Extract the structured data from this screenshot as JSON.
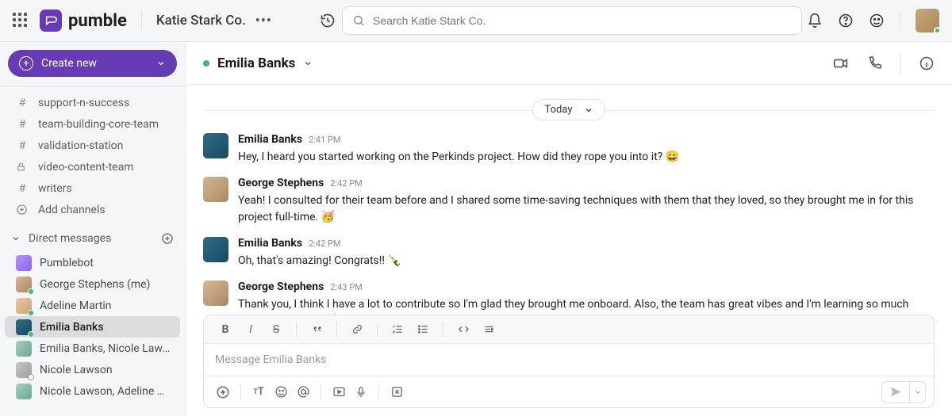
{
  "brand": "pumble",
  "org_name": "Katie Stark Co.",
  "search": {
    "placeholder": "Search Katie Stark Co."
  },
  "create_label": "Create new",
  "channels": [
    {
      "icon": "hash",
      "label": "support-n-success"
    },
    {
      "icon": "hash",
      "label": "team-building-core-team"
    },
    {
      "icon": "hash",
      "label": "validation-station"
    },
    {
      "icon": "lock",
      "label": "video-content-team"
    },
    {
      "icon": "hash",
      "label": "writers"
    }
  ],
  "add_channels_label": "Add channels",
  "dm_header": "Direct messages",
  "dms": [
    {
      "avatar": "bot",
      "label": "Pumblebot",
      "presence": "none",
      "selected": false
    },
    {
      "avatar": "u1",
      "label": "George Stephens (me)",
      "presence": "on",
      "selected": false
    },
    {
      "avatar": "u2",
      "label": "Adeline Martin",
      "presence": "on",
      "selected": false
    },
    {
      "avatar": "u3",
      "label": "Emilia Banks",
      "presence": "on",
      "selected": true
    },
    {
      "avatar": "grp",
      "label": "Emilia Banks, Nicole Lawson",
      "presence": "badge",
      "selected": false
    },
    {
      "avatar": "u4",
      "label": "Nicole Lawson",
      "presence": "off",
      "selected": false
    },
    {
      "avatar": "grp",
      "label": "Nicole Lawson, Adeline Mar...",
      "presence": "badge",
      "selected": false
    }
  ],
  "conversation": {
    "title": "Emilia Banks",
    "divider": "Today",
    "messages": [
      {
        "author": "Emilia Banks",
        "avatar": "emilia",
        "time": "2:41 PM",
        "text": "Hey, I heard you started working on the Perkinds project. How did they rope you into it? 😄"
      },
      {
        "author": "George Stephens",
        "avatar": "george",
        "time": "2:42 PM",
        "text": "Yeah! I consulted for their team before and I shared some time-saving techniques with them that they loved, so they brought me in for this project full-time. 🥳"
      },
      {
        "author": "Emilia Banks",
        "avatar": "emilia",
        "time": "2:42 PM",
        "text": "Oh, that's amazing! Congrats!! 🍾"
      },
      {
        "author": "George Stephens",
        "avatar": "george",
        "time": "2:43 PM",
        "text": "Thank you, I think I have a lot to contribute so I'm glad they brought me onboard. Also, the team has great vibes and I'm learning so much from all of them! 🥳"
      }
    ]
  },
  "composer": {
    "placeholder": "Message Emilia Banks"
  }
}
